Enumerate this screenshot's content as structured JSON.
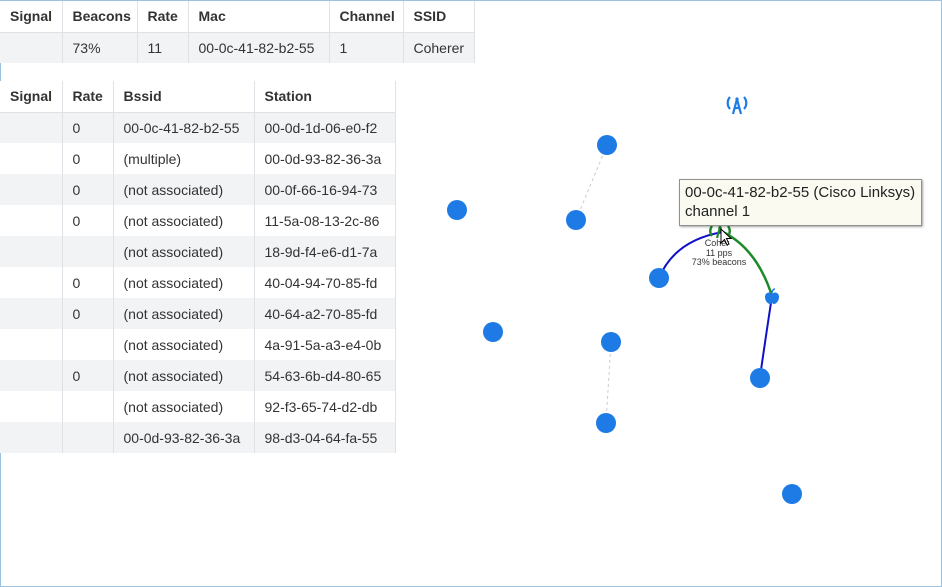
{
  "ap_table": {
    "headers": [
      "Signal",
      "Beacons",
      "Rate",
      "Mac",
      "Channel",
      "SSID"
    ],
    "rows": [
      [
        "",
        "73%",
        "11",
        "00-0c-41-82-b2-55",
        "1",
        "Coherer"
      ]
    ]
  },
  "client_table": {
    "headers": [
      "Signal",
      "Rate",
      "Bssid",
      "Station"
    ],
    "rows": [
      [
        "",
        "0",
        "00-0c-41-82-b2-55",
        "00-0d-1d-06-e0-f2"
      ],
      [
        "",
        "0",
        "(multiple)",
        "00-0d-93-82-36-3a"
      ],
      [
        "",
        "0",
        "(not associated)",
        "00-0f-66-16-94-73"
      ],
      [
        "",
        "0",
        "(not associated)",
        "11-5a-08-13-2c-86"
      ],
      [
        "",
        "",
        "(not associated)",
        "18-9d-f4-e6-d1-7a"
      ],
      [
        "",
        "0",
        "(not associated)",
        "40-04-94-70-85-fd"
      ],
      [
        "",
        "0",
        "(not associated)",
        "40-64-a2-70-85-fd"
      ],
      [
        "",
        "",
        "(not associated)",
        "4a-91-5a-a3-e4-0b"
      ],
      [
        "",
        "0",
        "(not associated)",
        "54-63-6b-d4-80-65"
      ],
      [
        "",
        "",
        "(not associated)",
        "92-f3-65-74-d2-db"
      ],
      [
        "",
        "",
        "00-0d-93-82-36-3a",
        "98-d3-04-64-fa-55"
      ]
    ]
  },
  "graph": {
    "ap_label": "Coher",
    "ap_pps": "11 pps",
    "ap_beacons": "73% beacons",
    "legend_icon": "access-point-icon",
    "ap_icon": "access-point-icon",
    "client_icon": "apple-icon",
    "colors": {
      "node": "#1e7be6",
      "ap": "#1d8a2a",
      "link_blue": "#1010c8",
      "link_green": "#1d8a2a",
      "dashed": "#cccccc"
    }
  },
  "tooltip": {
    "line1": "00-0c-41-82-b2-55 (Cisco Linksys)",
    "line2": "channel 1"
  }
}
